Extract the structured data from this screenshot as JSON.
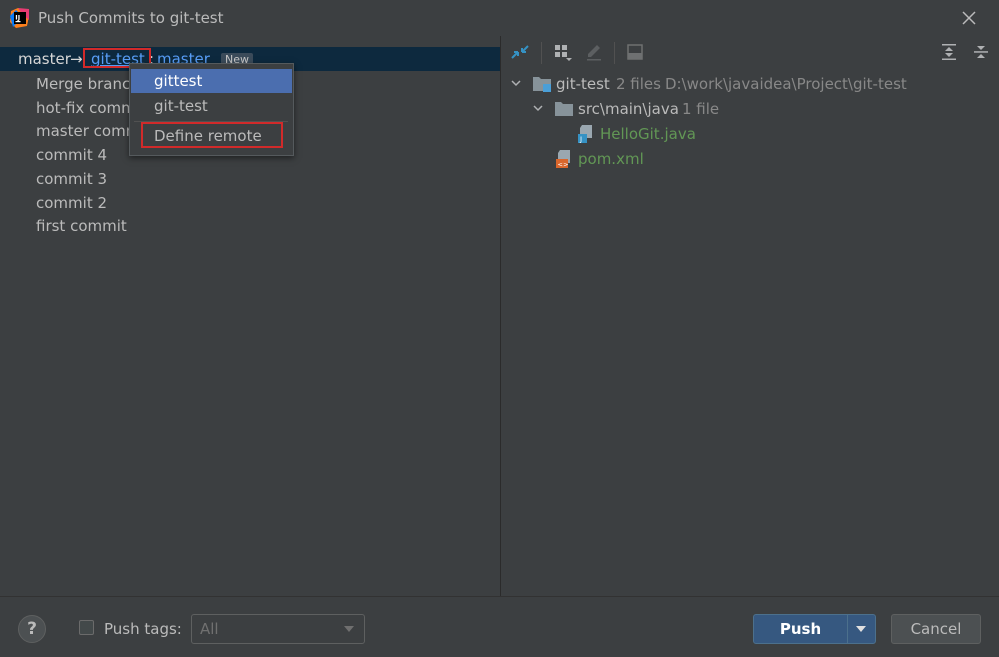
{
  "window": {
    "title": "Push Commits to git-test"
  },
  "repo_row": {
    "source_branch": "master",
    "arrow": "→",
    "remote": "git-test",
    "separator": ":",
    "target_branch": "master",
    "badge": "New"
  },
  "commits": [
    "Merge branc",
    "hot-fix comm",
    "master comm",
    "commit 4",
    "commit 3",
    "commit 2",
    "first commit"
  ],
  "remote_popup": {
    "items": [
      "gittest",
      "git-test"
    ],
    "define_remote": "Define remote"
  },
  "toolbar_icons": [
    "expand-arrows-icon",
    "group-by-icon",
    "edit-icon",
    "preview-icon",
    "expand-all-icon",
    "collapse-all-icon"
  ],
  "tree": {
    "root": {
      "name": "git-test",
      "count": "2 files",
      "path": "D:\\work\\javaidea\\Project\\git-test"
    },
    "folder": {
      "name": "src\\main\\java",
      "count": "1 file"
    },
    "files": [
      "HelloGit.java",
      "pom.xml"
    ]
  },
  "footer": {
    "help": "?",
    "push_tags_label": "Push tags:",
    "push_tags_value": "All",
    "push_button": "Push",
    "cancel_button": "Cancel"
  },
  "colors": {
    "background": "#3c3f41",
    "selection": "#0d293e",
    "popup_selected": "#4b6eaf",
    "link": "#589df6",
    "file_added": "#629755",
    "highlight_box": "#d12a2a",
    "push_button": "#365880"
  }
}
